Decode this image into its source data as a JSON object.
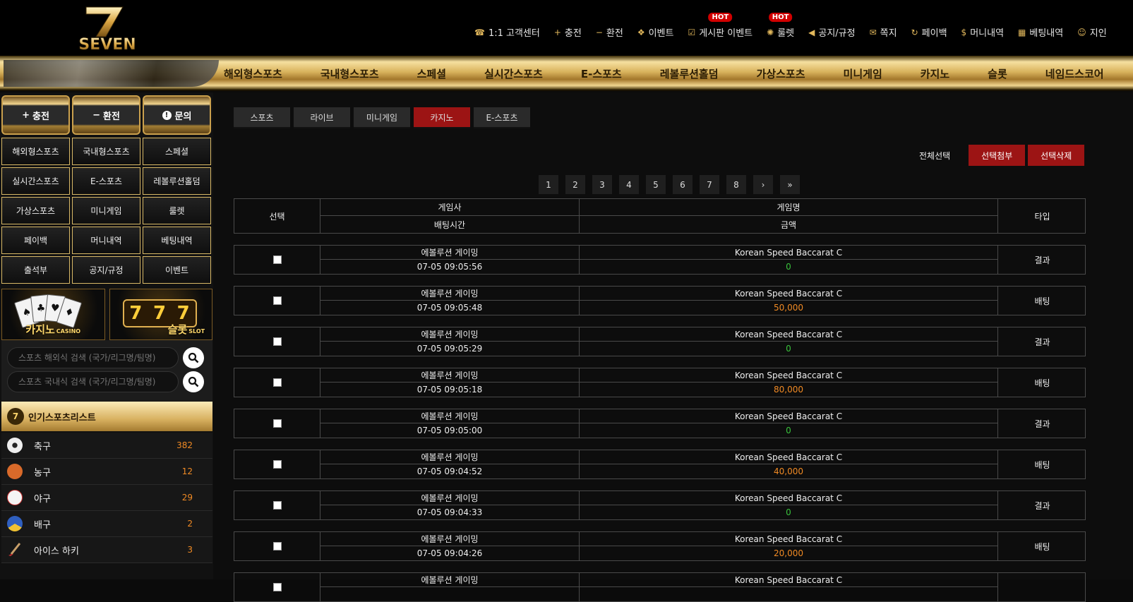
{
  "logo": {
    "text": "SEVEN",
    "digit": "7"
  },
  "top_links": [
    {
      "label": "1:1 고객센터",
      "icon": "headset-icon",
      "glyph": "☎",
      "hot": ""
    },
    {
      "label": "충전",
      "icon": "plus-icon",
      "glyph": "+",
      "hot": ""
    },
    {
      "label": "환전",
      "icon": "minus-icon",
      "glyph": "−",
      "hot": ""
    },
    {
      "label": "이벤트",
      "icon": "gift-icon",
      "glyph": "❖",
      "hot": ""
    },
    {
      "label": "게시판 이벤트",
      "icon": "checkbox-icon",
      "glyph": "☑",
      "hot": "HOT"
    },
    {
      "label": "룰렛",
      "icon": "roulette-icon",
      "glyph": "✺",
      "hot": "HOT"
    },
    {
      "label": "공지/규정",
      "icon": "megaphone-icon",
      "glyph": "◀",
      "hot": ""
    },
    {
      "label": "쪽지",
      "icon": "mail-icon",
      "glyph": "✉",
      "hot": ""
    },
    {
      "label": "페이백",
      "icon": "refresh-icon",
      "glyph": "↻",
      "hot": ""
    },
    {
      "label": "머니내역",
      "icon": "moneybag-icon",
      "glyph": "$",
      "hot": ""
    },
    {
      "label": "베팅내역",
      "icon": "ticket-icon",
      "glyph": "▦",
      "hot": ""
    },
    {
      "label": "지인",
      "icon": "users-icon",
      "glyph": "☺",
      "hot": ""
    }
  ],
  "gnav": [
    "해외형스포츠",
    "국내형스포츠",
    "스페셜",
    "실시간스포츠",
    "E-스포츠",
    "레볼루션홀덤",
    "가상스포츠",
    "미니게임",
    "카지노",
    "슬롯",
    "네임드스코어"
  ],
  "side_buttons": [
    {
      "label": "충전",
      "glyph": "+"
    },
    {
      "label": "환전",
      "glyph": "−"
    },
    {
      "label": "문의",
      "glyph": "!"
    }
  ],
  "side_grid": [
    "해외형스포츠",
    "국내형스포츠",
    "스페셜",
    "실시간스포츠",
    "E-스포츠",
    "레볼루션홀덤",
    "가상스포츠",
    "미니게임",
    "룰렛",
    "페이백",
    "머니내역",
    "베팅내역",
    "출석부",
    "공지/규정",
    "이벤트"
  ],
  "banners": [
    {
      "label": "카지노",
      "sub": "CASINO"
    },
    {
      "label": "슬롯",
      "sub": "SLOT"
    }
  ],
  "search": {
    "overseas_placeholder": "스포츠 해외식 검색 (국가/리그명/팀명)",
    "domestic_placeholder": "스포츠 국내식 검색 (국가/리그명/팀명)"
  },
  "popular": {
    "title": "인기스포츠리스트",
    "badge": "7",
    "items": [
      {
        "name": "축구",
        "count": "382",
        "color": "#e8e8e8"
      },
      {
        "name": "농구",
        "count": "12",
        "color": "#d96a2a"
      },
      {
        "name": "야구",
        "count": "29",
        "color": "#f4f4f4"
      },
      {
        "name": "배구",
        "count": "2",
        "color": "#2f5fbf"
      },
      {
        "name": "아이스 하키",
        "count": "3",
        "color": "#171717"
      }
    ]
  },
  "tabs": [
    {
      "label": "스포츠",
      "active": false
    },
    {
      "label": "라이브",
      "active": false
    },
    {
      "label": "미니게임",
      "active": false
    },
    {
      "label": "카지노",
      "active": true
    },
    {
      "label": "E-스포츠",
      "active": false
    }
  ],
  "actions": {
    "select_all": "전체선택",
    "attach": "선택첨부",
    "delete": "선택삭제"
  },
  "pager": [
    "1",
    "2",
    "3",
    "4",
    "5",
    "6",
    "7",
    "8",
    "›",
    "»"
  ],
  "table": {
    "head": {
      "select": "선택",
      "provider": "게임사",
      "bet_time": "배팅시간",
      "game_name": "게임명",
      "amount": "금액",
      "type": "타입"
    },
    "rows": [
      {
        "provider": "에볼루션 게이밍",
        "time": "07-05 09:05:56",
        "game": "Korean Speed Baccarat C",
        "amount": "0",
        "type": "결과"
      },
      {
        "provider": "에볼루션 게이밍",
        "time": "07-05 09:05:48",
        "game": "Korean Speed Baccarat C",
        "amount": "50,000",
        "type": "배팅"
      },
      {
        "provider": "에볼루션 게이밍",
        "time": "07-05 09:05:29",
        "game": "Korean Speed Baccarat C",
        "amount": "0",
        "type": "결과"
      },
      {
        "provider": "에볼루션 게이밍",
        "time": "07-05 09:05:18",
        "game": "Korean Speed Baccarat C",
        "amount": "80,000",
        "type": "배팅"
      },
      {
        "provider": "에볼루션 게이밍",
        "time": "07-05 09:05:00",
        "game": "Korean Speed Baccarat C",
        "amount": "0",
        "type": "결과"
      },
      {
        "provider": "에볼루션 게이밍",
        "time": "07-05 09:04:52",
        "game": "Korean Speed Baccarat C",
        "amount": "40,000",
        "type": "배팅"
      },
      {
        "provider": "에볼루션 게이밍",
        "time": "07-05 09:04:33",
        "game": "Korean Speed Baccarat C",
        "amount": "0",
        "type": "결과"
      },
      {
        "provider": "에볼루션 게이밍",
        "time": "07-05 09:04:26",
        "game": "Korean Speed Baccarat C",
        "amount": "20,000",
        "type": "배팅"
      },
      {
        "provider": "에볼루션 게이밍",
        "time": "",
        "game": "Korean Speed Baccarat C",
        "amount": "",
        "type": ""
      }
    ]
  }
}
